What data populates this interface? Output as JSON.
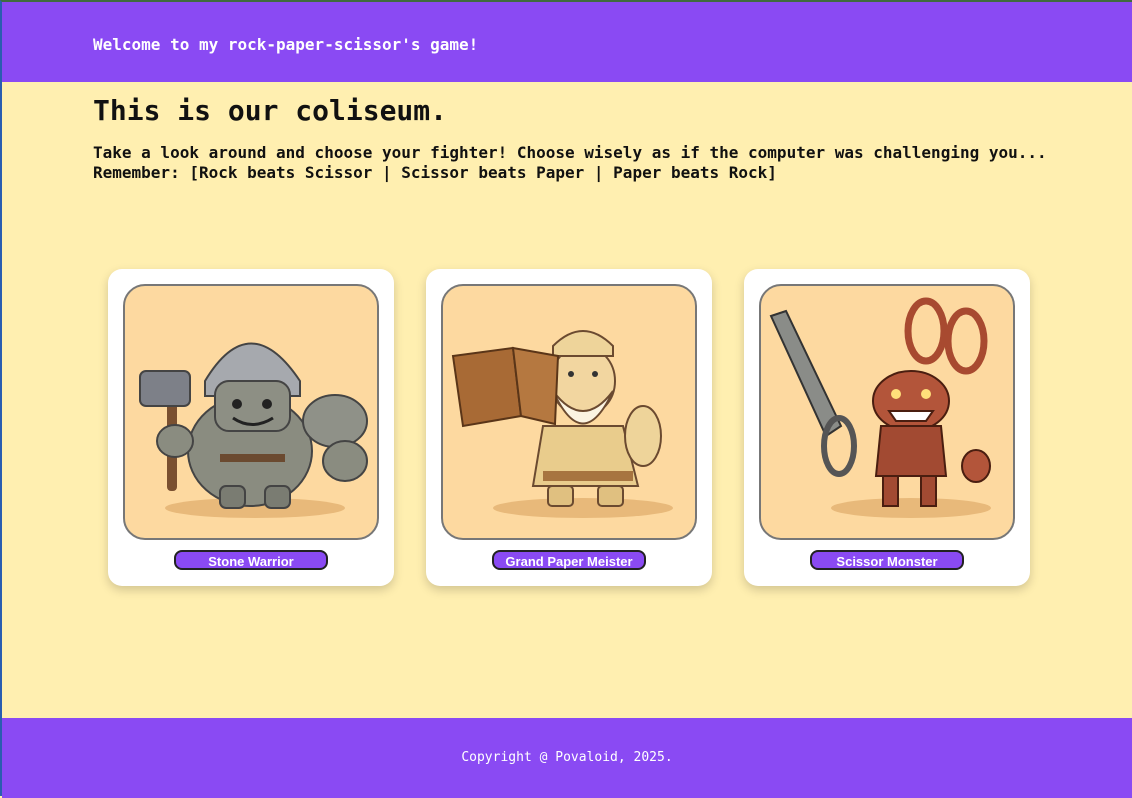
{
  "header": {
    "welcome": "Welcome to my rock-paper-scissor's game!"
  },
  "main": {
    "title": "This is our coliseum.",
    "lines": [
      "Take a look around and choose your fighter! Choose wisely as if the computer was challenging you...",
      "Remember: [Rock beats Scissor | Scissor beats Paper | Paper beats Rock]"
    ]
  },
  "fighters": [
    {
      "name": "Stone Warrior"
    },
    {
      "name": "Grand Paper Meister"
    },
    {
      "name": "Scissor Monster"
    }
  ],
  "footer": {
    "copyright": "Copyright @ Povaloid, 2025."
  },
  "colors": {
    "accent": "#8a4af3",
    "background": "#ffefb0",
    "card": "#ffffff"
  }
}
